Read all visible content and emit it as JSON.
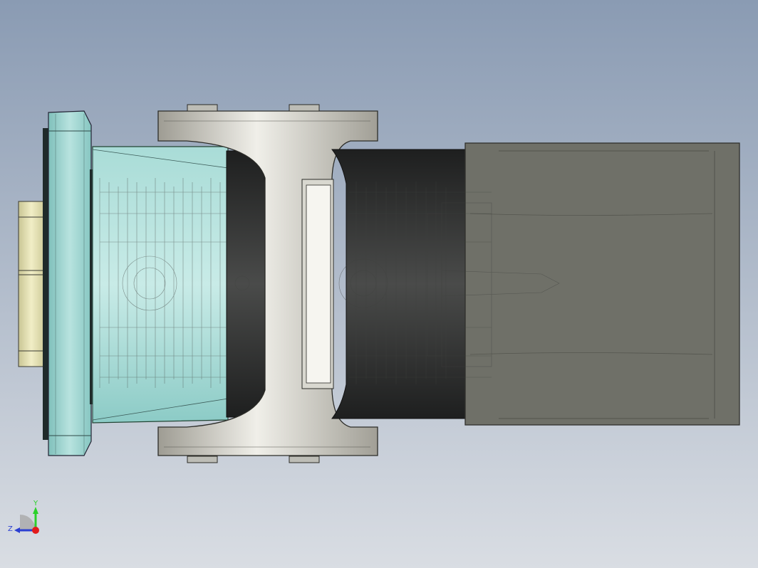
{
  "viewport": {
    "background_top": "#8a9bb3",
    "background_bottom": "#d9dde3"
  },
  "model": {
    "colors": {
      "flange": "#9fd3cf",
      "flange_dark": "#5f9e9a",
      "bearing": "#e9e6b8",
      "bearing_dark": "#b9b58a",
      "yoke": "#c9c7bd",
      "yoke_light": "#ecebe4",
      "yoke_dark": "#8f8d84",
      "sleeve_dark": "#2e2f2f",
      "housing": "#6f7068",
      "housing_edge": "#3c3d38",
      "bolt": "#bdbdb6",
      "wire": "#40423f"
    }
  },
  "triad": {
    "y_label": "Y",
    "z_label": "Z",
    "y_color": "#2bd12b",
    "z_color": "#2b3fd1",
    "origin_color": "#e31b1b"
  }
}
